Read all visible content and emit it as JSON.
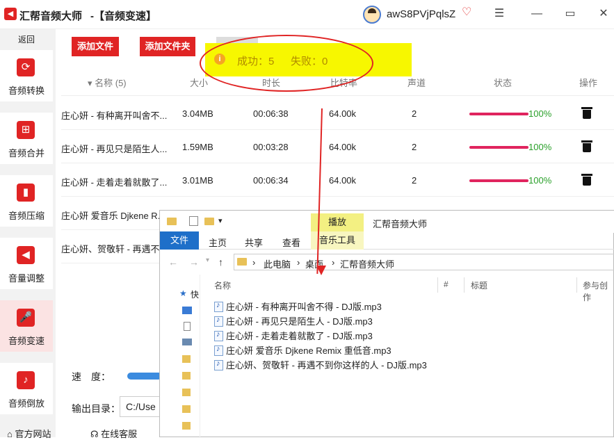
{
  "titlebar": {
    "app_title": "汇帮音频大师",
    "module_title": "-【音频变速】",
    "username": "awS8PVjPqlsZ",
    "menu_icon": "☰",
    "minimize_icon": "—",
    "maximize_icon": "▭",
    "close_icon": "✕"
  },
  "sidebar": {
    "back": "返回",
    "items": [
      {
        "label": "音频转换",
        "icon": "⟳"
      },
      {
        "label": "音频合并",
        "icon": "⊞"
      },
      {
        "label": "音频压缩",
        "icon": "▮"
      },
      {
        "label": "音量调整",
        "icon": "◀"
      },
      {
        "label": "音频变速",
        "icon": "🎤"
      },
      {
        "label": "音频倒放",
        "icon": "♪"
      }
    ],
    "official_site": "官方网站",
    "online_service": "在线客服"
  },
  "toolbar": {
    "add_file": "添加文件",
    "add_folder": "添加文件夹"
  },
  "toast": {
    "success": "成功：5",
    "fail": "失败：0"
  },
  "table": {
    "headers": [
      "▾ 名称 (5)",
      "大小",
      "时长",
      "比特率",
      "声道",
      "状态",
      "操作"
    ],
    "rows": [
      {
        "name": "庄心妍 - 有种离开叫舍不...",
        "size": "3.04MB",
        "duration": "00:06:38",
        "bitrate": "64.00k",
        "channels": "2",
        "progress": 1.0,
        "status": "100%"
      },
      {
        "name": "庄心妍 - 再见只是陌生人...",
        "size": "1.59MB",
        "duration": "00:03:28",
        "bitrate": "64.00k",
        "channels": "2",
        "progress": 1.0,
        "status": "100%"
      },
      {
        "name": "庄心妍 - 走着走着就散了...",
        "size": "3.01MB",
        "duration": "00:06:34",
        "bitrate": "64.00k",
        "channels": "2",
        "progress": 1.0,
        "status": "100%"
      },
      {
        "name": "庄心妍 爱音乐 Djkene R...",
        "size": "",
        "duration": "",
        "bitrate": "",
        "channels": "",
        "status": ""
      },
      {
        "name": "庄心妍、贺敬轩 - 再遇不...",
        "size": "",
        "duration": "",
        "bitrate": "",
        "channels": "",
        "status": ""
      }
    ]
  },
  "settings": {
    "speed_label": "速　度：",
    "output_label": "输出目录：",
    "output_value": "C:/Use"
  },
  "explorer": {
    "title": "汇帮音频大师",
    "context_tab": "播放",
    "context_sub": "音乐工具",
    "ribbon_tabs": [
      "文件",
      "主页",
      "共享",
      "查看"
    ],
    "breadcrumb": [
      "此电脑",
      "桌面",
      "汇帮音频大师"
    ],
    "quick_access": "快",
    "columns": [
      "名称",
      "#",
      "标题",
      "参与创作"
    ],
    "files": [
      "庄心妍 - 有种离开叫舍不得 - DJ版.mp3",
      "庄心妍 - 再见只是陌生人 - DJ版.mp3",
      "庄心妍 - 走着走着就散了 - DJ版.mp3",
      "庄心妍 爱音乐 Djkene Remix 重低音.mp3",
      "庄心妍、贺敬轩 - 再遇不到你这样的人 - DJ版.mp3"
    ]
  },
  "colors": {
    "accent": "#e02424",
    "progress": "#e0245e",
    "success_text": "#2aa02a",
    "toast_bg": "#f7f700",
    "explorer_file_tab": "#1e6fc9"
  }
}
